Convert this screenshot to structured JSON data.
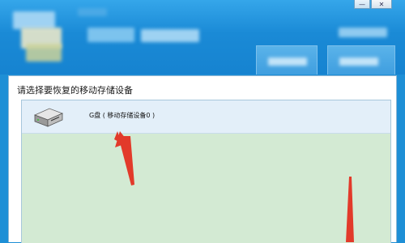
{
  "window": {
    "minimize_glyph": "—",
    "close_glyph": "✕"
  },
  "content": {
    "prompt": "请选择要恢复的移动存储设备",
    "devices": [
      {
        "label": "G盘 ( 移动存储设备0 )",
        "icon": "removable-drive-icon"
      }
    ]
  },
  "colors": {
    "titlebar": "#1a8ad6",
    "list_bg": "#d3ead3",
    "selected_row": "#e3eff9",
    "annotation_arrow": "#e23a2a"
  }
}
